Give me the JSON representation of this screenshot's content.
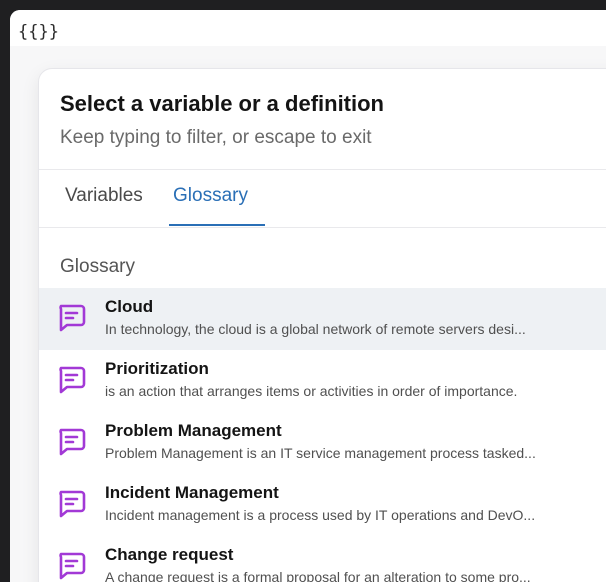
{
  "editor": {
    "text": "{{}}"
  },
  "popup": {
    "title": "Select a variable or a definition",
    "subtitle": "Keep typing to filter, or escape to exit",
    "tabs": [
      {
        "label": "Variables",
        "selected": false
      },
      {
        "label": "Glossary",
        "selected": true
      }
    ],
    "section_label": "Glossary",
    "items": [
      {
        "title": "Cloud",
        "description": "In technology, the cloud is a global network of remote servers desi...",
        "icon": "comment-icon"
      },
      {
        "title": "Prioritization",
        "description": "is an action that arranges items or activities in order of importance.",
        "icon": "comment-icon"
      },
      {
        "title": "Problem Management",
        "description": "Problem Management is an IT service management process tasked...",
        "icon": "comment-icon"
      },
      {
        "title": "Incident Management",
        "description": "Incident management is a process used by IT operations and DevO...",
        "icon": "comment-icon"
      },
      {
        "title": "Change request",
        "description": "A change request is a formal proposal for an alteration to some pro...",
        "icon": "comment-icon"
      }
    ]
  },
  "colors": {
    "accent": "#2a6fb6",
    "icon": "#a239d6",
    "active_row": "#eef1f4"
  }
}
